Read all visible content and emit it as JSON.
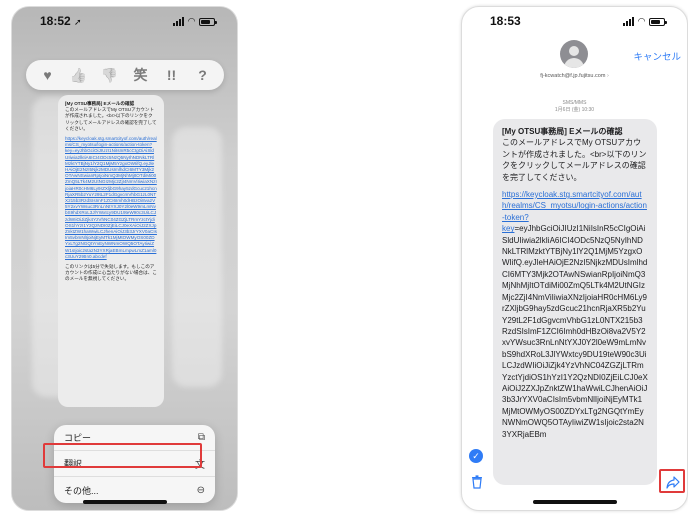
{
  "left_phone": {
    "status": {
      "time": "18:52",
      "location_icon": "location-arrow-icon"
    },
    "reactions": [
      {
        "name": "heart-icon",
        "glyph": "♥"
      },
      {
        "name": "thumbs-up-icon",
        "glyph": "👍"
      },
      {
        "name": "thumbs-down-icon",
        "glyph": "👎"
      },
      {
        "name": "haha-icon",
        "glyph": "笑"
      },
      {
        "name": "exclamation-icon",
        "glyph": "!!"
      },
      {
        "name": "question-icon",
        "glyph": "?"
      }
    ],
    "message": {
      "title": "[My OTSU事務局] Eメールの確認",
      "intro": "このメールアドレスでMy OTSUアカウントが作成されました。<br>以下のリンクをクリックしてメールアドレスの確認を完了してください。",
      "link": "https://keycloak.stg.smartcityof.com/auth/realms/CS_myotsu/login-actions/action-token?",
      "body": "key=eyJhbGciOiJIUzI1NiIsInR5cCIgOiAiSldUIiwia2lkIiA6ICI4ODc5NzQ5NyIhNDNkLTRlMzktYTBjNy1lY2Q1MjM5YzgxOWIifQ.eyJleHAiOjE2NzI5NjkzMDUsImlhdCI6MTY3Mjk2OTAwNSwianRpIjoiNmQ3MjNhMjItOTdiMi00ZmQ5LTk4M2UtNGIzMjc2ZjI4NmViIiwiaXNzIjoiaHR0cHM6Ly9rZXljbG9hay5zdGcuc21hcnRjaXR5b2YuY29tL2F1dGgvcmVhbG1zL0NTX215b3RzdSIsImF1ZCI6Imh0dHBzOi8va2V5Y2xvYWsuc3RnLnNtYXJ0Y2l0eW9mLmNvbS9hdXRoL3JlYWxtcy9DU19teW90c3UiLCJzdWIiOiJiZjk4YzVhNC04ZGZjLTRmYzctYjdiOS1hYzI1Y2QzNDI0ZjEiLCJ0eXAiOiJ2ZXJpZnktZW1haWwiLCJhenAiOiJ3b3JrYXV0aCIsIm5vbmNlIjoiNjEyMTk1MjMtOWMyOS00ZDYxLTg2NGQtYmEyNWNmOWQ5OTAyIiwiZW1sIjoic2sta2N3YXRjaEBmLmpwLmZ1aml0c3UuY29tIn0.abcdef",
      "footer": "このリンクは5分で失効します。もしこのアカウントの作成に心当たりがない場合は、このメールを無視してください。"
    },
    "menu": [
      {
        "name": "copy-menu-item",
        "label": "コピー",
        "icon_name": "copy-icon",
        "icon": "⧉"
      },
      {
        "name": "translate-menu-item",
        "label": "翻訳",
        "icon_name": "translate-icon",
        "icon": "文"
      },
      {
        "name": "more-menu-item",
        "label": "その他...",
        "icon_name": "more-circle-icon",
        "icon": "⊖"
      }
    ]
  },
  "right_phone": {
    "status": {
      "time": "18:53"
    },
    "header": {
      "cancel_label": "キャンセル",
      "email": "fj-kcwatch@f.jp.fujitsu.com",
      "chevron": "›"
    },
    "meta": {
      "line1": "SMS/MMS",
      "line2": "1月6日 (金) 10:30"
    },
    "message": {
      "title": "[My OTSU事務局] Eメールの確認",
      "intro": "このメールアドレスでMy OTSUアカウントが作成されました。<br>以下のリンクをクリックしてメールアドレスの確認を完了してください。",
      "link": "https://keycloak.stg.smartcityof.com/auth/realms/CS_myotsu/login-actions/action-token?",
      "key_label": "key",
      "body": "=eyJhbGciOiJIUzI1NiIsInR5cCIgOiAiSldUIiwia2lkIiA6ICI4ODc5NzQ5NyIhNDNkLTRlMzktYTBjNy1lY2Q1MjM5YzgxOWIifQ.eyJleHAiOjE2NzI5NjkzMDUsImlhdCI6MTY3Mjk2OTAwNSwianRpIjoiNmQ3MjNhMjItOTdiMi00ZmQ5LTk4M2UtNGIzMjc2ZjI4NmViIiwiaXNzIjoiaHR0cHM6Ly9rZXljbG9hay5zdGcuc21hcnRjaXR5b2YuY29tL2F1dGgvcmVhbG1zL0NTX215b3RzdSIsImF1ZCI6Imh0dHBzOi8va2V5Y2xvYWsuc3RnLnNtYXJ0Y2l0eW9mLmNvbS9hdXRoL3JlYWxtcy9DU19teW90c3UiLCJzdWIiOiJiZjk4YzVhNC04ZGZjLTRmYzctYjdiOS1hYzI1Y2QzNDI0ZjEiLCJ0eXAiOiJ2ZXJpZnktZW1haWwiLCJhenAiOiJ3b3JrYXV0aCIsIm5vbmNlIjoiNjEyMTk1MjMtOWMyOS00ZDYxLTg2NGQtYmEyNWNmOWQ5OTAyIiwiZW1sIjoic2sta2N3YXRjaEBm"
    },
    "check_glyph": "✓"
  },
  "colors": {
    "accent": "#2f7cf6",
    "highlight": "#e03a3a",
    "bubble": "#e9e9eb"
  }
}
